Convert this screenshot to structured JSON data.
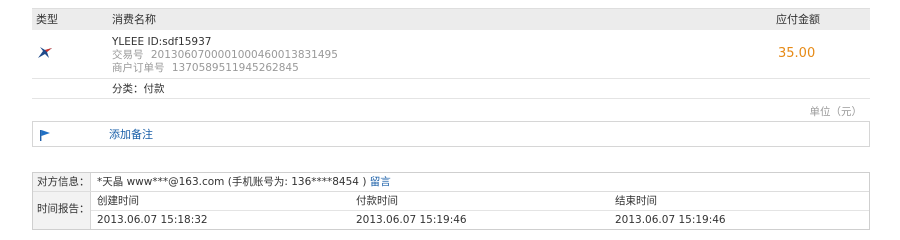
{
  "header": {
    "col_type": "类型",
    "col_name": "消费名称",
    "col_amount": "应付金额"
  },
  "item": {
    "icon": "swallow-bird-icon",
    "title": "YLEEE ID:sdf15937",
    "trade_no_label": "交易号",
    "trade_no": "2013060700001000460013831495",
    "order_no_label": "商户订单号",
    "order_no": "1370589511945262845",
    "amount": "35.00",
    "category": "分类：付款"
  },
  "unit": "单位（元）",
  "memo": {
    "icon": "flag-icon",
    "link": "添加备注"
  },
  "info": {
    "party_label": "对方信息：",
    "party_text": "*天晶  www***@163.com (手机账号为: 136****8454 )",
    "party_link": "留言",
    "report_label": "时间报告：",
    "time_headers": [
      "创建时间",
      "付款时间",
      "结束时间"
    ],
    "time_values": [
      "2013.06.07 15:18:32",
      "2013.06.07 15:19:46",
      "2013.06.07 15:19:46"
    ]
  },
  "colors": {
    "amount": "#e68a16",
    "link": "#1a5fa8",
    "muted": "#999999",
    "header_bg": "#ececec"
  }
}
